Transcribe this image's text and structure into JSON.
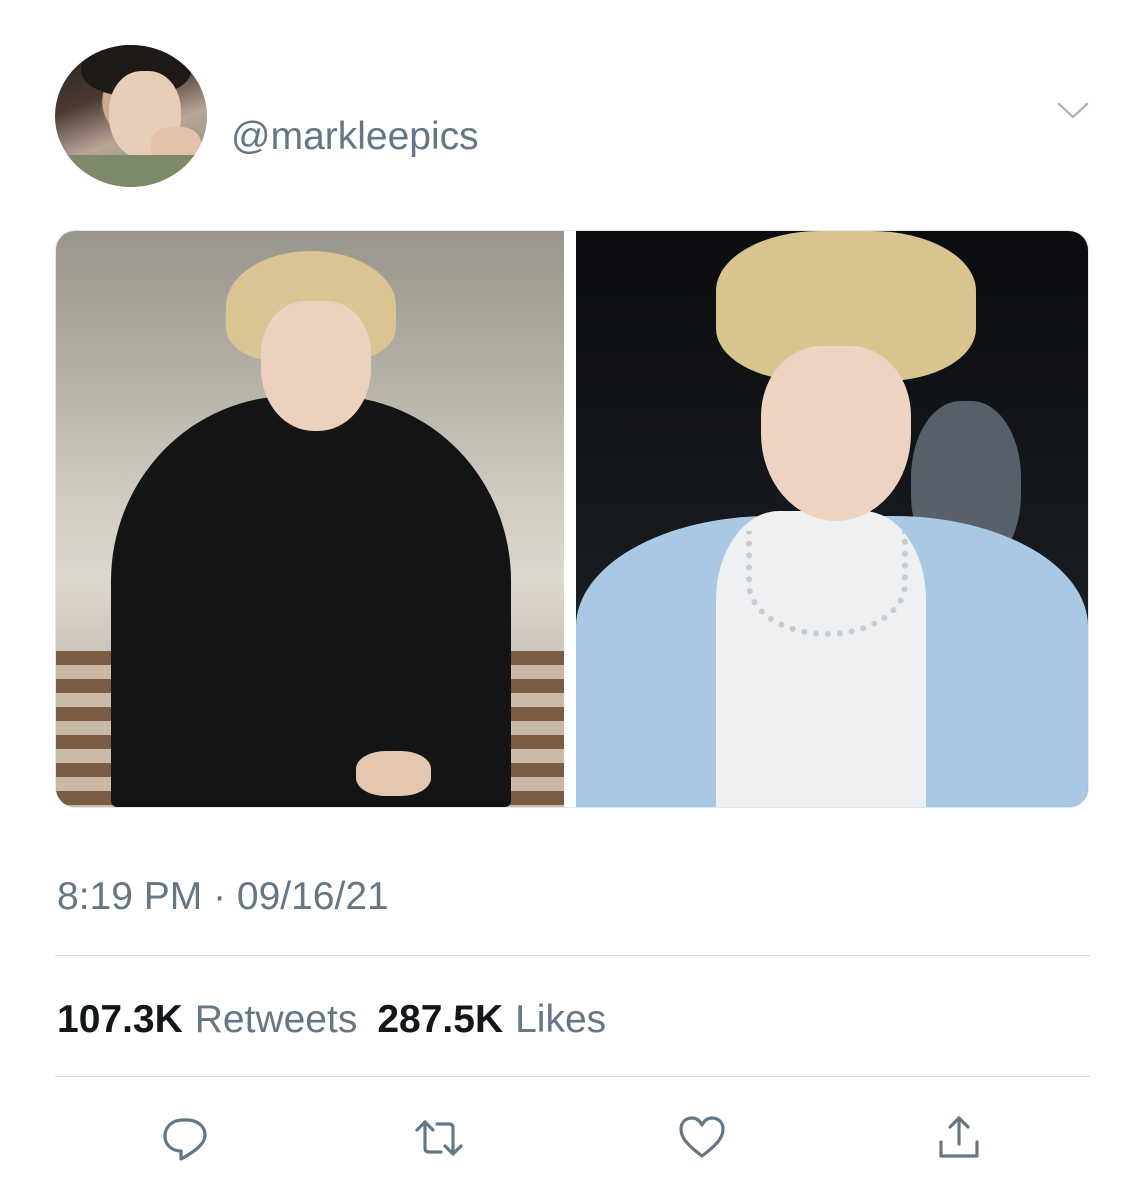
{
  "tweet": {
    "handle": "@markleepics",
    "timestamp": "8:19 PM · 09/16/21",
    "stats": {
      "retweets_count": "107.3K",
      "retweets_label": "Retweets",
      "likes_count": "287.5K",
      "likes_label": "Likes"
    },
    "icons": {
      "menu": "chevron-down-icon",
      "reply": "reply-icon",
      "retweet": "retweet-icon",
      "like": "heart-icon",
      "share": "share-icon"
    },
    "colors": {
      "secondary_text": "#657786",
      "primary_text": "#14171a",
      "divider": "#d5dde3"
    }
  }
}
